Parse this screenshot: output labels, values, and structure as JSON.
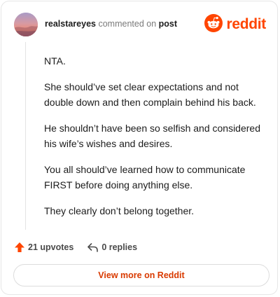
{
  "header": {
    "username": "realstareyes",
    "action_text": "commented on",
    "target_text": "post",
    "brand_name": "reddit",
    "brand_color": "#ff4500"
  },
  "comment": {
    "paragraphs": [
      "NTA.",
      "She should’ve set clear expectations and not double down and then complain behind his back.",
      "He shouldn’t have been so selfish and considered his wife’s wishes and desires.",
      "You all should’ve learned how to communicate FIRST before doing anything else.",
      "They clearly don’t belong together."
    ]
  },
  "actions": {
    "upvotes_label": "21 upvotes",
    "upvote_icon": "upvote-arrow-icon",
    "upvote_color": "#ff4500",
    "replies_label": "0 replies",
    "reply_icon": "reply-arrow-icon"
  },
  "footer": {
    "view_more_label": "View more on Reddit",
    "link_color": "#d93a00"
  }
}
